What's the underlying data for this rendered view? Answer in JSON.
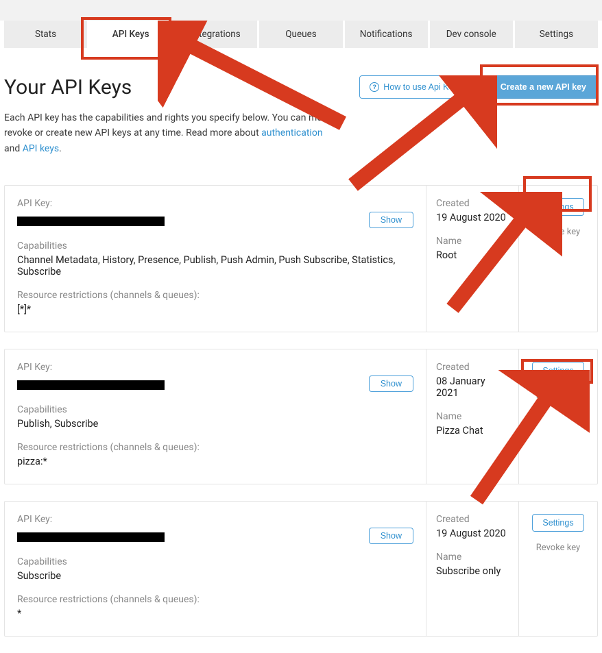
{
  "tabs": [
    {
      "label": "Stats",
      "active": false
    },
    {
      "label": "API Keys",
      "active": true
    },
    {
      "label": "Integrations",
      "active": false
    },
    {
      "label": "Queues",
      "active": false
    },
    {
      "label": "Notifications",
      "active": false
    },
    {
      "label": "Dev console",
      "active": false
    },
    {
      "label": "Settings",
      "active": false
    }
  ],
  "header": {
    "title": "Your API Keys",
    "how_to_label": "How to use Api Key",
    "create_label": "Create a new API key"
  },
  "intro": {
    "line1": "Each API key has the capabilities and rights you specify below. You can modify, revoke or create new API keys at any time. Read more about ",
    "link1": "authentication",
    "mid": " and ",
    "link2": "API keys",
    "end": "."
  },
  "labels": {
    "api_key": "API Key:",
    "capabilities": "Capabilities",
    "restrictions": "Resource restrictions (channels & queues):",
    "created": "Created",
    "name": "Name",
    "show": "Show",
    "settings": "Settings",
    "revoke": "Revoke key"
  },
  "keys": [
    {
      "capabilities": "Channel Metadata, History, Presence, Publish, Push Admin, Push Subscribe, Statistics, Subscribe",
      "restrictions": "[*]*",
      "created": "19 August 2020",
      "name": "Root"
    },
    {
      "capabilities": "Publish, Subscribe",
      "restrictions": "pizza:*",
      "created": "08 January 2021",
      "name": "Pizza Chat"
    },
    {
      "capabilities": "Subscribe",
      "restrictions": "*",
      "created": "19 August 2020",
      "name": "Subscribe only"
    }
  ]
}
